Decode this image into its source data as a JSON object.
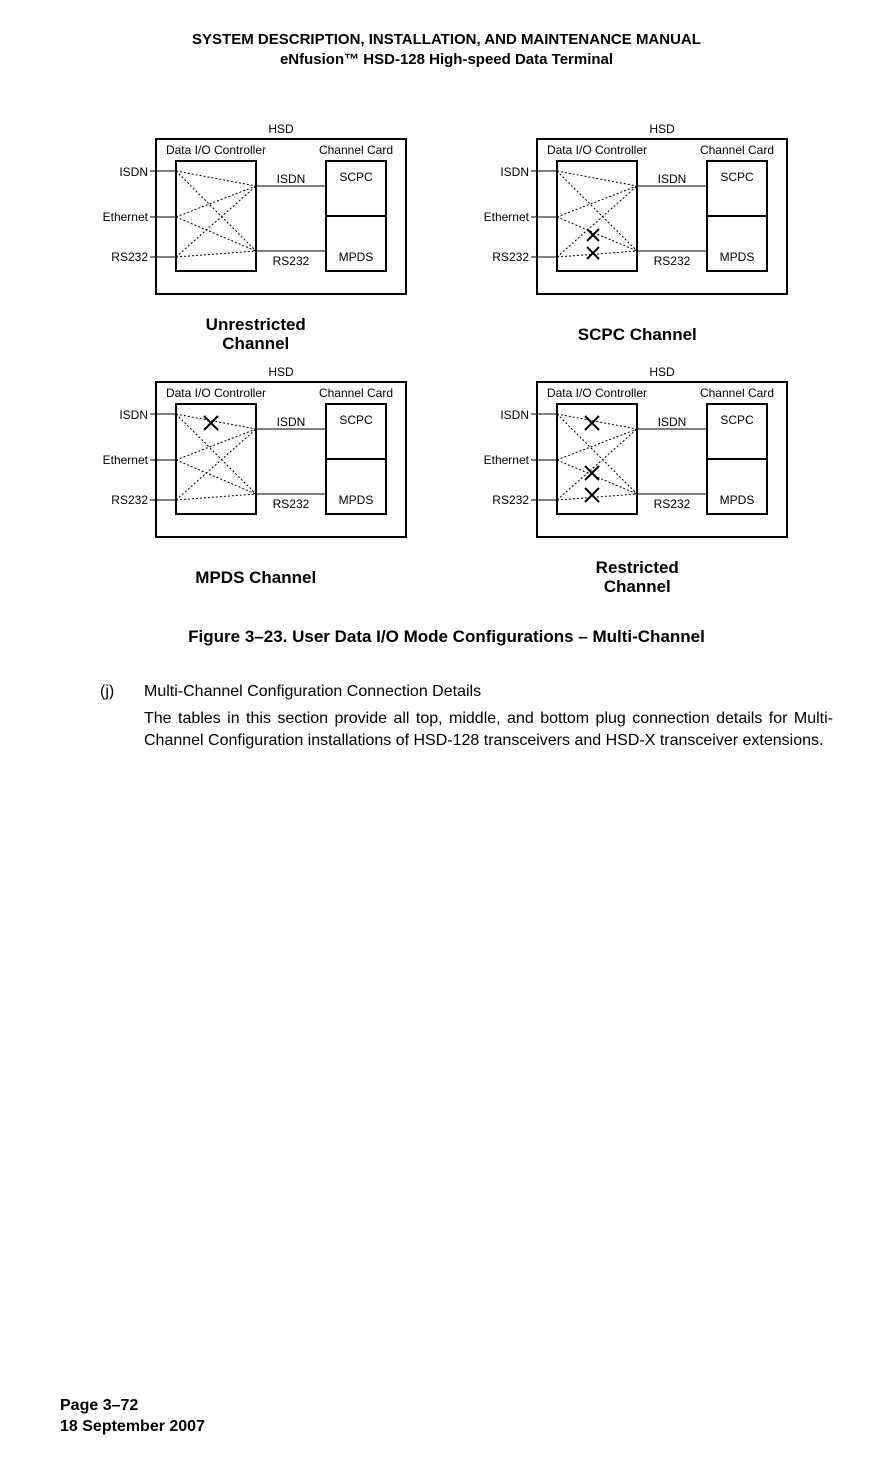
{
  "header": {
    "line1": "SYSTEM DESCRIPTION, INSTALLATION, AND MAINTENANCE MANUAL",
    "line2": "eNfusion™ HSD-128 High-speed Data Terminal"
  },
  "diagram": {
    "hsd": "HSD",
    "dataio": "Data I/O Controller",
    "channelcard": "Channel Card",
    "isdn_left": "ISDN",
    "ethernet_left": "Ethernet",
    "rs232_left": "RS232",
    "isdn_mid": "ISDN",
    "rs232_mid": "RS232",
    "scpc": "SCPC",
    "mpds": "MPDS"
  },
  "captions": {
    "tl1": "Unrestricted",
    "tl2": "Channel",
    "tr": "SCPC Channel",
    "bl": "MPDS Channel",
    "br1": "Restricted",
    "br2": "Channel"
  },
  "figure_caption": "Figure 3–23. User Data I/O Mode Configurations – Multi-Channel",
  "section": {
    "marker": "(j)",
    "title": "Multi-Channel Configuration Connection Details",
    "para": "The tables in this section provide all top, middle, and bottom plug connection details for Multi-Channel Configuration installations of HSD-128 transceivers and HSD-X transceiver extensions."
  },
  "footer": {
    "page": "Page 3–72",
    "date": "18 September 2007"
  }
}
